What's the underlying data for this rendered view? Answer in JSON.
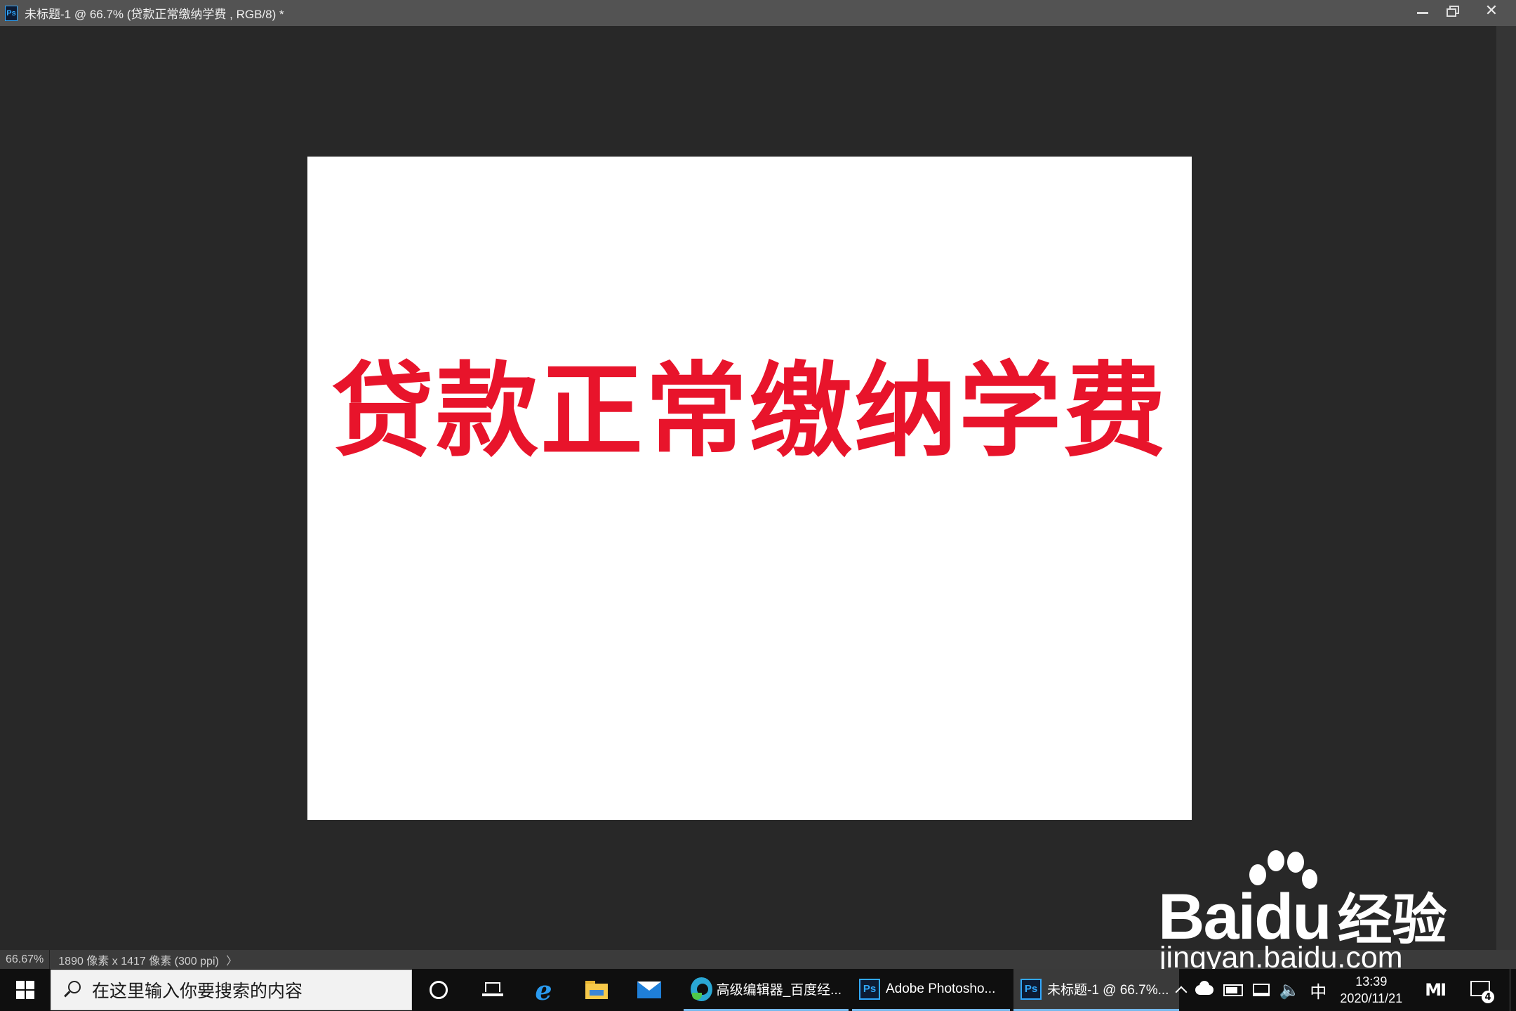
{
  "window": {
    "app_badge": "Ps",
    "title": "未标题-1 @ 66.7% (贷款正常缴纳学费 , RGB/8) *",
    "close_glyph": "✕"
  },
  "canvas": {
    "text": "贷款正常缴纳学费",
    "text_color": "#e8142b",
    "background": "#ffffff"
  },
  "statusbar": {
    "zoom": "66.67%",
    "doc_info": "1890 像素 x 1417 像素 (300 ppi)",
    "arrow": "〉"
  },
  "watermark": {
    "logo_text": "Baidu",
    "logo_cn": "经验",
    "url": "jingyan.baidu.com"
  },
  "taskbar": {
    "search_placeholder": "在这里输入你要搜索的内容",
    "ie_glyph": "e",
    "apps": [
      {
        "label": "高级编辑器_百度经...",
        "icon": "edge-icon"
      },
      {
        "label": "Adobe Photosho...",
        "icon": "photoshop-icon"
      },
      {
        "label": "未标题-1 @ 66.7%...",
        "icon": "photoshop-icon",
        "active": true
      }
    ],
    "ps_badge": "Ps",
    "tray": {
      "chevron": "^",
      "ime": "中",
      "volume_glyph": "🔈",
      "time": "13:39",
      "date": "2020/11/21",
      "mi_glyph": "MI",
      "notification_count": "4"
    }
  },
  "colors": {
    "workspace": "#282828",
    "titlebar": "#535353",
    "taskbar": "#0f0f0f",
    "accent_blue": "#31a8ff",
    "text_red": "#e8142b"
  }
}
